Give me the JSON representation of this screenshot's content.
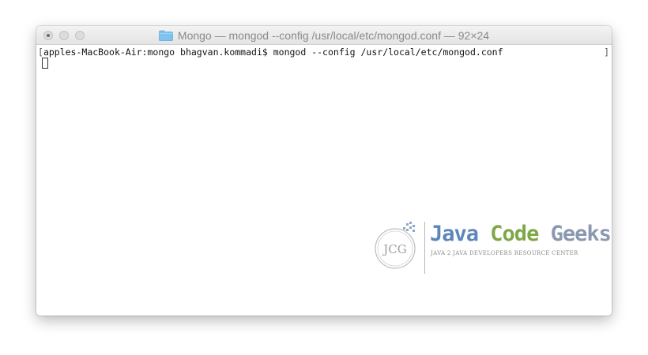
{
  "window": {
    "title": "Mongo — mongod --config /usr/local/etc/mongod.conf — 92×24",
    "folder_icon": "folder-icon",
    "buttons": [
      "close",
      "minimize",
      "zoom"
    ]
  },
  "terminal": {
    "left_bracket": "[",
    "prompt": "apples-MacBook-Air:mongo bhagvan.kommadi$ ",
    "command": "mongod --config /usr/local/etc/mongod.conf",
    "right_bracket": "]"
  },
  "watermark": {
    "logo_text": "JCG",
    "brand_java": "Java",
    "brand_code": "Code",
    "brand_geeks": "Geeks",
    "tagline": "JAVA 2 JAVA DEVELOPERS RESOURCE CENTER"
  },
  "colors": {
    "java_blue": "#5d86b9",
    "code_green": "#7ea847",
    "geeks_grey": "#8a98b0",
    "folder_blue": "#7ec3ee"
  }
}
